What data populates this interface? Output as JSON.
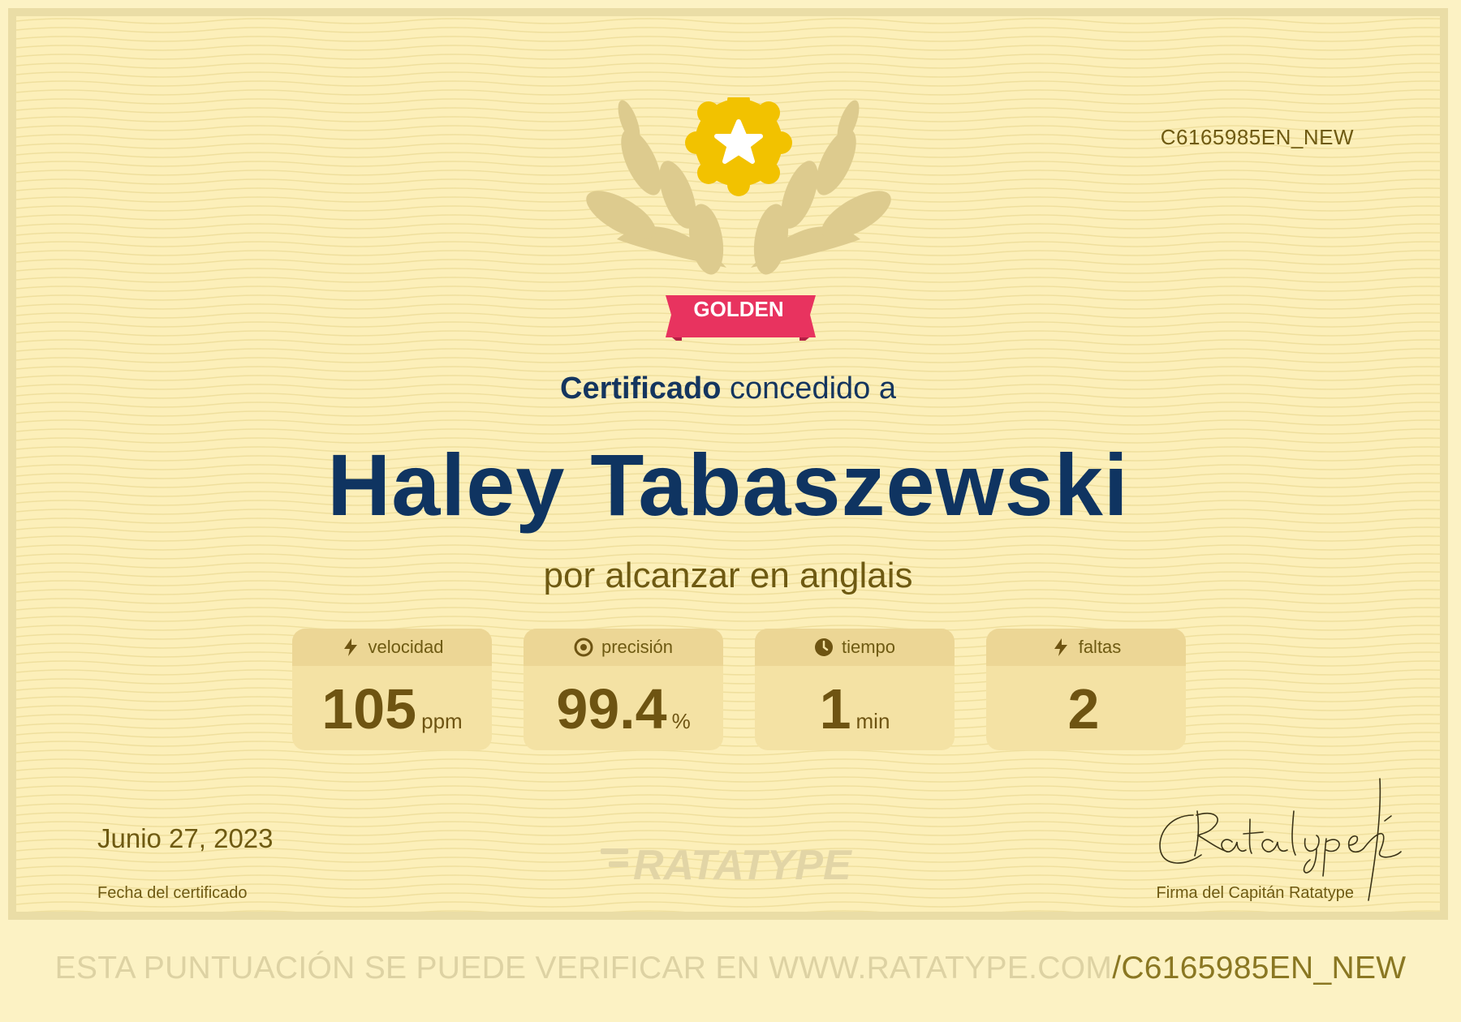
{
  "certificate": {
    "id": "C6165985EN_NEW",
    "level_badge": "GOLDEN",
    "title_bold": "Certificado",
    "title_rest": " concedido a",
    "recipient": "Haley Tabaszewski",
    "subtitle": "por alcanzar en anglais",
    "stats": [
      {
        "label": "velocidad",
        "value": "105",
        "unit": "ppm",
        "icon": "lightning-icon"
      },
      {
        "label": "precisión",
        "value": "99.4",
        "unit": "%",
        "icon": "target-icon"
      },
      {
        "label": "tiempo",
        "value": "1",
        "unit": "min",
        "icon": "clock-icon"
      },
      {
        "label": "faltas",
        "value": "2",
        "unit": "",
        "icon": "lightning-icon"
      }
    ],
    "date": "Junio 27, 2023",
    "date_label": "Fecha del certificado",
    "brand": "RATATYPE",
    "signature_label": "Firma del Capitán Ratatype"
  },
  "footer": {
    "text": "ESTA PUNTUACIÓN SE PUEDE VERIFICAR EN WWW.RATATYPE.COM",
    "code": "/C6165985EN_NEW"
  },
  "colors": {
    "background": "#fcefb9",
    "navy": "#0f3461",
    "olive": "#6e5a12",
    "gold": "#f2c200",
    "ribbon": "#e8335f"
  }
}
